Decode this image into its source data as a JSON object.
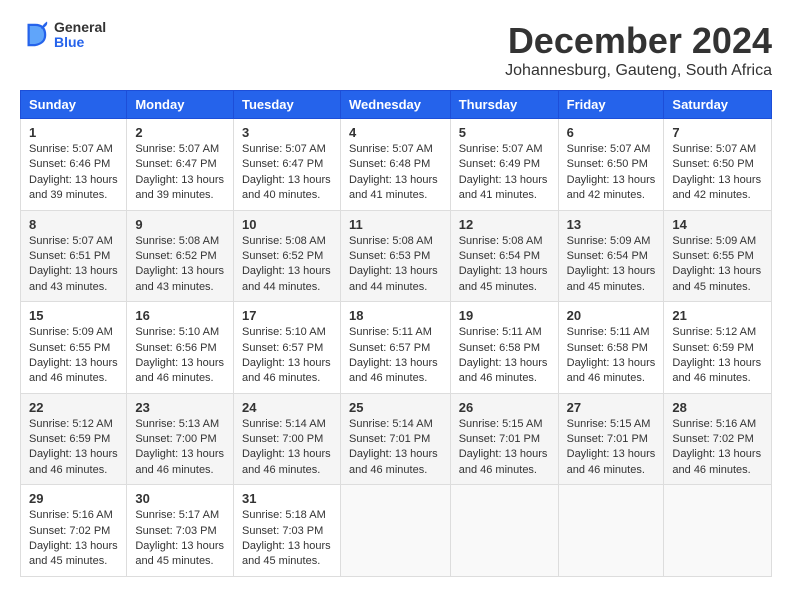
{
  "logo": {
    "general": "General",
    "blue": "Blue"
  },
  "title": "December 2024",
  "location": "Johannesburg, Gauteng, South Africa",
  "days_of_week": [
    "Sunday",
    "Monday",
    "Tuesday",
    "Wednesday",
    "Thursday",
    "Friday",
    "Saturday"
  ],
  "weeks": [
    [
      {
        "day": "1",
        "sunrise": "5:07 AM",
        "sunset": "6:46 PM",
        "daylight": "13 hours and 39 minutes."
      },
      {
        "day": "2",
        "sunrise": "5:07 AM",
        "sunset": "6:47 PM",
        "daylight": "13 hours and 39 minutes."
      },
      {
        "day": "3",
        "sunrise": "5:07 AM",
        "sunset": "6:47 PM",
        "daylight": "13 hours and 40 minutes."
      },
      {
        "day": "4",
        "sunrise": "5:07 AM",
        "sunset": "6:48 PM",
        "daylight": "13 hours and 41 minutes."
      },
      {
        "day": "5",
        "sunrise": "5:07 AM",
        "sunset": "6:49 PM",
        "daylight": "13 hours and 41 minutes."
      },
      {
        "day": "6",
        "sunrise": "5:07 AM",
        "sunset": "6:50 PM",
        "daylight": "13 hours and 42 minutes."
      },
      {
        "day": "7",
        "sunrise": "5:07 AM",
        "sunset": "6:50 PM",
        "daylight": "13 hours and 42 minutes."
      }
    ],
    [
      {
        "day": "8",
        "sunrise": "5:07 AM",
        "sunset": "6:51 PM",
        "daylight": "13 hours and 43 minutes."
      },
      {
        "day": "9",
        "sunrise": "5:08 AM",
        "sunset": "6:52 PM",
        "daylight": "13 hours and 43 minutes."
      },
      {
        "day": "10",
        "sunrise": "5:08 AM",
        "sunset": "6:52 PM",
        "daylight": "13 hours and 44 minutes."
      },
      {
        "day": "11",
        "sunrise": "5:08 AM",
        "sunset": "6:53 PM",
        "daylight": "13 hours and 44 minutes."
      },
      {
        "day": "12",
        "sunrise": "5:08 AM",
        "sunset": "6:54 PM",
        "daylight": "13 hours and 45 minutes."
      },
      {
        "day": "13",
        "sunrise": "5:09 AM",
        "sunset": "6:54 PM",
        "daylight": "13 hours and 45 minutes."
      },
      {
        "day": "14",
        "sunrise": "5:09 AM",
        "sunset": "6:55 PM",
        "daylight": "13 hours and 45 minutes."
      }
    ],
    [
      {
        "day": "15",
        "sunrise": "5:09 AM",
        "sunset": "6:55 PM",
        "daylight": "13 hours and 46 minutes."
      },
      {
        "day": "16",
        "sunrise": "5:10 AM",
        "sunset": "6:56 PM",
        "daylight": "13 hours and 46 minutes."
      },
      {
        "day": "17",
        "sunrise": "5:10 AM",
        "sunset": "6:57 PM",
        "daylight": "13 hours and 46 minutes."
      },
      {
        "day": "18",
        "sunrise": "5:11 AM",
        "sunset": "6:57 PM",
        "daylight": "13 hours and 46 minutes."
      },
      {
        "day": "19",
        "sunrise": "5:11 AM",
        "sunset": "6:58 PM",
        "daylight": "13 hours and 46 minutes."
      },
      {
        "day": "20",
        "sunrise": "5:11 AM",
        "sunset": "6:58 PM",
        "daylight": "13 hours and 46 minutes."
      },
      {
        "day": "21",
        "sunrise": "5:12 AM",
        "sunset": "6:59 PM",
        "daylight": "13 hours and 46 minutes."
      }
    ],
    [
      {
        "day": "22",
        "sunrise": "5:12 AM",
        "sunset": "6:59 PM",
        "daylight": "13 hours and 46 minutes."
      },
      {
        "day": "23",
        "sunrise": "5:13 AM",
        "sunset": "7:00 PM",
        "daylight": "13 hours and 46 minutes."
      },
      {
        "day": "24",
        "sunrise": "5:14 AM",
        "sunset": "7:00 PM",
        "daylight": "13 hours and 46 minutes."
      },
      {
        "day": "25",
        "sunrise": "5:14 AM",
        "sunset": "7:01 PM",
        "daylight": "13 hours and 46 minutes."
      },
      {
        "day": "26",
        "sunrise": "5:15 AM",
        "sunset": "7:01 PM",
        "daylight": "13 hours and 46 minutes."
      },
      {
        "day": "27",
        "sunrise": "5:15 AM",
        "sunset": "7:01 PM",
        "daylight": "13 hours and 46 minutes."
      },
      {
        "day": "28",
        "sunrise": "5:16 AM",
        "sunset": "7:02 PM",
        "daylight": "13 hours and 46 minutes."
      }
    ],
    [
      {
        "day": "29",
        "sunrise": "5:16 AM",
        "sunset": "7:02 PM",
        "daylight": "13 hours and 45 minutes."
      },
      {
        "day": "30",
        "sunrise": "5:17 AM",
        "sunset": "7:03 PM",
        "daylight": "13 hours and 45 minutes."
      },
      {
        "day": "31",
        "sunrise": "5:18 AM",
        "sunset": "7:03 PM",
        "daylight": "13 hours and 45 minutes."
      },
      null,
      null,
      null,
      null
    ]
  ],
  "labels": {
    "sunrise_prefix": "Sunrise: ",
    "sunset_prefix": "Sunset: ",
    "daylight_prefix": "Daylight: "
  }
}
